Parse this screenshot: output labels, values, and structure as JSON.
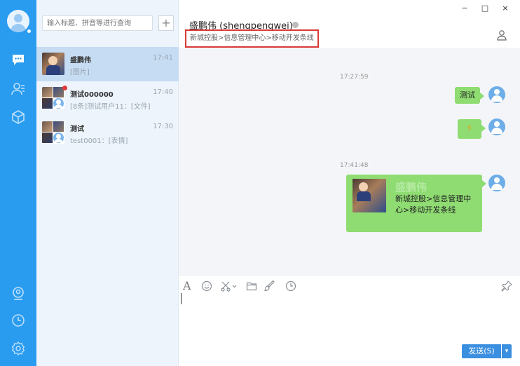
{
  "window_controls": {
    "minimize": "−",
    "maximize": "□",
    "close": "×"
  },
  "rail": {
    "icons": [
      "user-avatar",
      "chat-icon",
      "contacts-icon",
      "apps-cube-icon",
      "location-icon",
      "history-clock-icon",
      "settings-gear-icon"
    ]
  },
  "list": {
    "search_placeholder": "输入标题、拼音等进行查询",
    "add_label": "+",
    "conversations": [
      {
        "name": "盛鹏伟",
        "time": "17:41",
        "preview": "[图片]"
      },
      {
        "name": "测试000000",
        "time": "17:40",
        "preview": "[8条]测试用户11：[文件]"
      },
      {
        "name": "测试",
        "time": "17:30",
        "preview": "test0001：[表情]"
      }
    ]
  },
  "chat": {
    "title": "盛鹏伟 (shengpengwei)",
    "org_path": "新城控股>信息管理中心>移动开发条线",
    "messages": [
      {
        "timestamp": "17:27:59",
        "text": "测试"
      },
      {
        "text": "⚡"
      },
      {
        "timestamp": "17:41:48",
        "card_name": "盛鹏伟",
        "card_path": "新城控股>信息管理中心>移动开发条线"
      }
    ],
    "send_label": "发送(S)",
    "send_dropdown": "▾"
  },
  "colors": {
    "rail": "#2a9cf0",
    "bubble": "#8fdc72",
    "highlight_box": "#d93a36"
  }
}
